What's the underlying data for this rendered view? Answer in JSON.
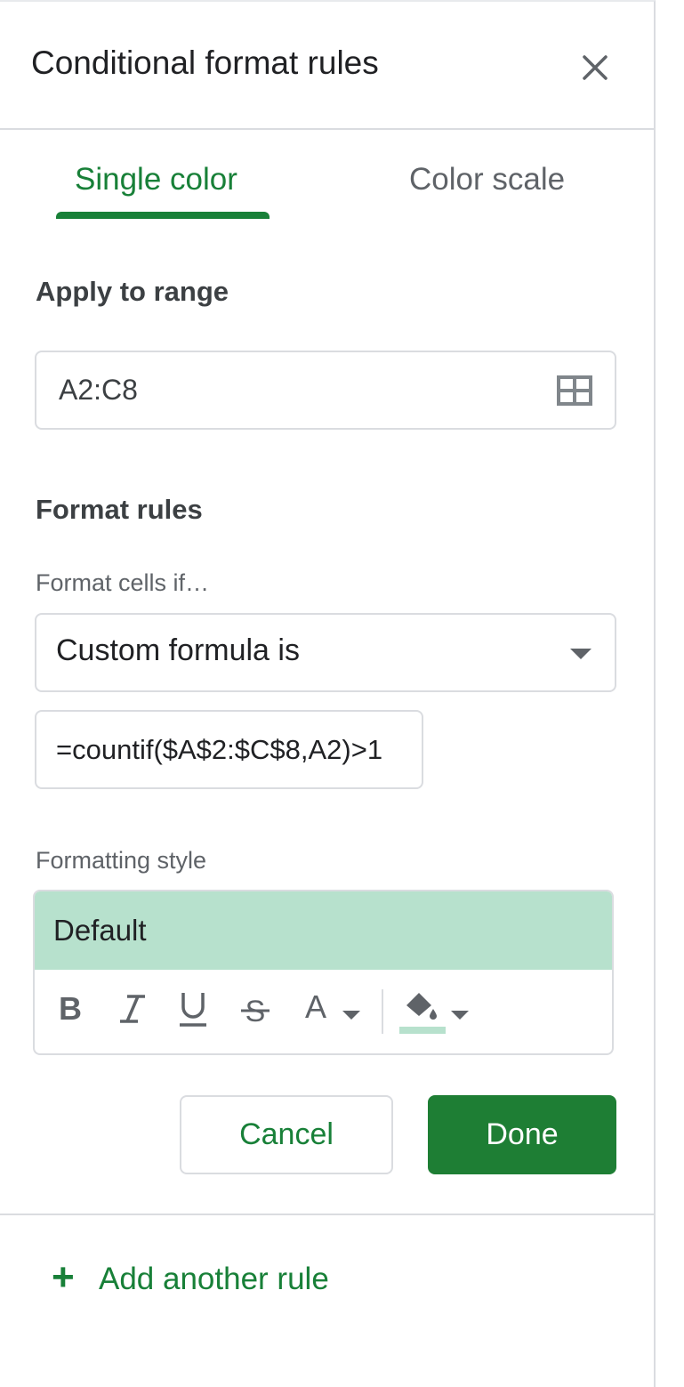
{
  "header": {
    "title": "Conditional format rules"
  },
  "tabs": [
    {
      "label": "Single color",
      "active": true
    },
    {
      "label": "Color scale",
      "active": false
    }
  ],
  "range": {
    "section_label": "Apply to range",
    "value": "A2:C8"
  },
  "rules": {
    "section_label": "Format rules",
    "condition_label": "Format cells if…",
    "condition_value": "Custom formula is",
    "formula_value": "=countif($A$2:$C$8,A2)>1"
  },
  "formatting": {
    "label": "Formatting style",
    "preview_text": "Default",
    "preview_color": "#b7e1cd",
    "toolbar": [
      "bold-icon",
      "italic-icon",
      "underline-icon",
      "strikethrough-icon",
      "text-color-icon",
      "fill-color-icon"
    ]
  },
  "actions": {
    "cancel_label": "Cancel",
    "done_label": "Done"
  },
  "add_rule": {
    "label": "Add another rule"
  },
  "colors": {
    "accent": "#188038",
    "done_bg": "#1e7e34",
    "muted": "#5f6368",
    "border": "#dadce0"
  }
}
